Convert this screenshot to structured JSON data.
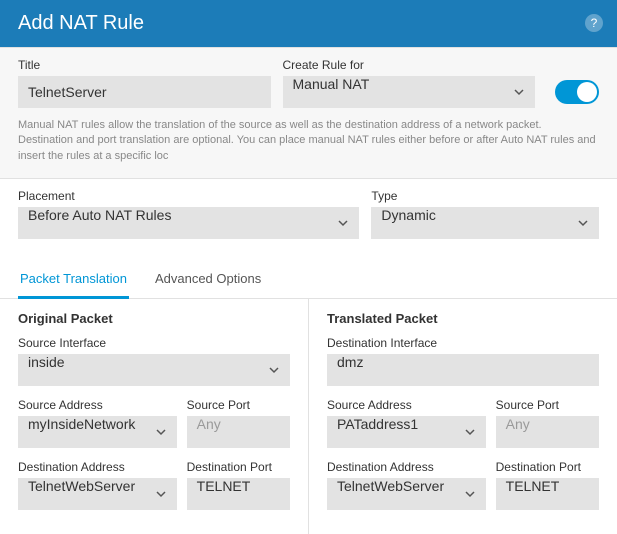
{
  "header": {
    "title": "Add NAT Rule"
  },
  "top": {
    "title_label": "Title",
    "title_value": "TelnetServer",
    "createfor_label": "Create Rule for",
    "createfor_value": "Manual NAT",
    "description": "Manual NAT rules allow the translation of the source as well as the destination address of a network packet. Destination and port translation are optional. You can place manual NAT rules either before or after Auto NAT rules and insert the rules at a specific loc"
  },
  "placement": {
    "label": "Placement",
    "value": "Before Auto NAT Rules",
    "type_label": "Type",
    "type_value": "Dynamic"
  },
  "tabs": {
    "packet": "Packet Translation",
    "advanced": "Advanced Options"
  },
  "original": {
    "heading": "Original Packet",
    "src_iface_label": "Source Interface",
    "src_iface_value": "inside",
    "src_addr_label": "Source Address",
    "src_addr_value": "myInsideNetwork",
    "src_port_label": "Source Port",
    "src_port_value": "Any",
    "dst_addr_label": "Destination Address",
    "dst_addr_value": "TelnetWebServer",
    "dst_port_label": "Destination Port",
    "dst_port_value": "TELNET"
  },
  "translated": {
    "heading": "Translated Packet",
    "dst_iface_label": "Destination Interface",
    "dst_iface_value": "dmz",
    "src_addr_label": "Source Address",
    "src_addr_value": "PATaddress1",
    "src_port_label": "Source Port",
    "src_port_value": "Any",
    "dst_addr_label": "Destination Address",
    "dst_addr_value": "TelnetWebServer",
    "dst_port_label": "Destination Port",
    "dst_port_value": "TELNET"
  }
}
